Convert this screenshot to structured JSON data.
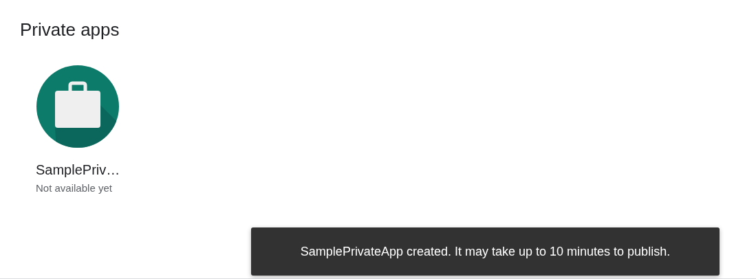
{
  "section": {
    "title": "Private apps"
  },
  "apps": [
    {
      "name": "SamplePriv…",
      "status": "Not available yet"
    }
  ],
  "snackbar": {
    "message": "SamplePrivateApp created. It may take up to 10 minutes to publish."
  }
}
